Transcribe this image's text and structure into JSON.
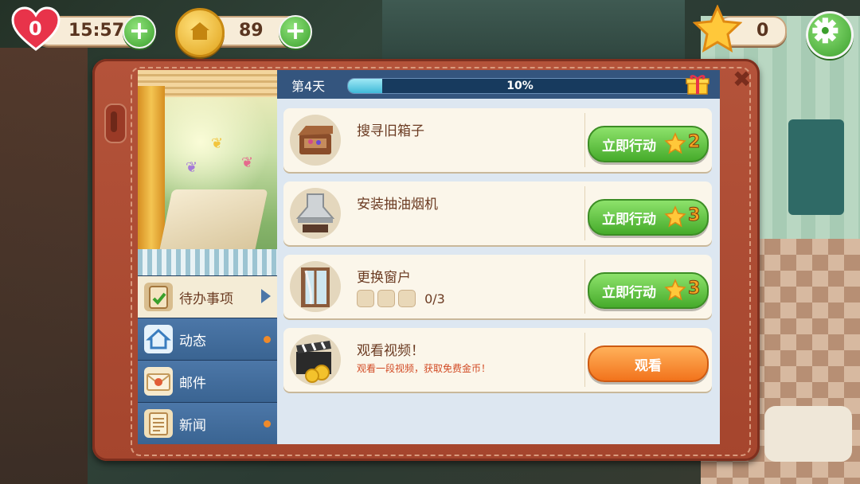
{
  "hud": {
    "lives": "0",
    "timer": "15:57",
    "coins": "89",
    "stars": "0",
    "add_label": "+"
  },
  "panel": {
    "day_label": "第4天",
    "progress_percent": 10,
    "progress_text": "10%",
    "close_label": "✖"
  },
  "nav": [
    {
      "label": "待办事项",
      "active": true
    },
    {
      "label": "动态",
      "badge": true
    },
    {
      "label": "邮件",
      "badge": false
    },
    {
      "label": "新闻",
      "badge": true
    }
  ],
  "tasks": [
    {
      "title": "搜寻旧箱子",
      "button": "立即行动",
      "stars": "2"
    },
    {
      "title": "安装抽油烟机",
      "button": "立即行动",
      "stars": "3"
    },
    {
      "title": "更换窗户",
      "button": "立即行动",
      "stars": "3",
      "progress": "0/3"
    }
  ],
  "video": {
    "title": "观看视频！",
    "subtitle": "观看一段视频，获取免费金币！",
    "button": "观看"
  },
  "colors": {
    "board": "#b4533a",
    "nav_blue": "#34557e",
    "green_button": "#46ab2b",
    "orange_button": "#f2731c",
    "star": "#f5a623"
  }
}
